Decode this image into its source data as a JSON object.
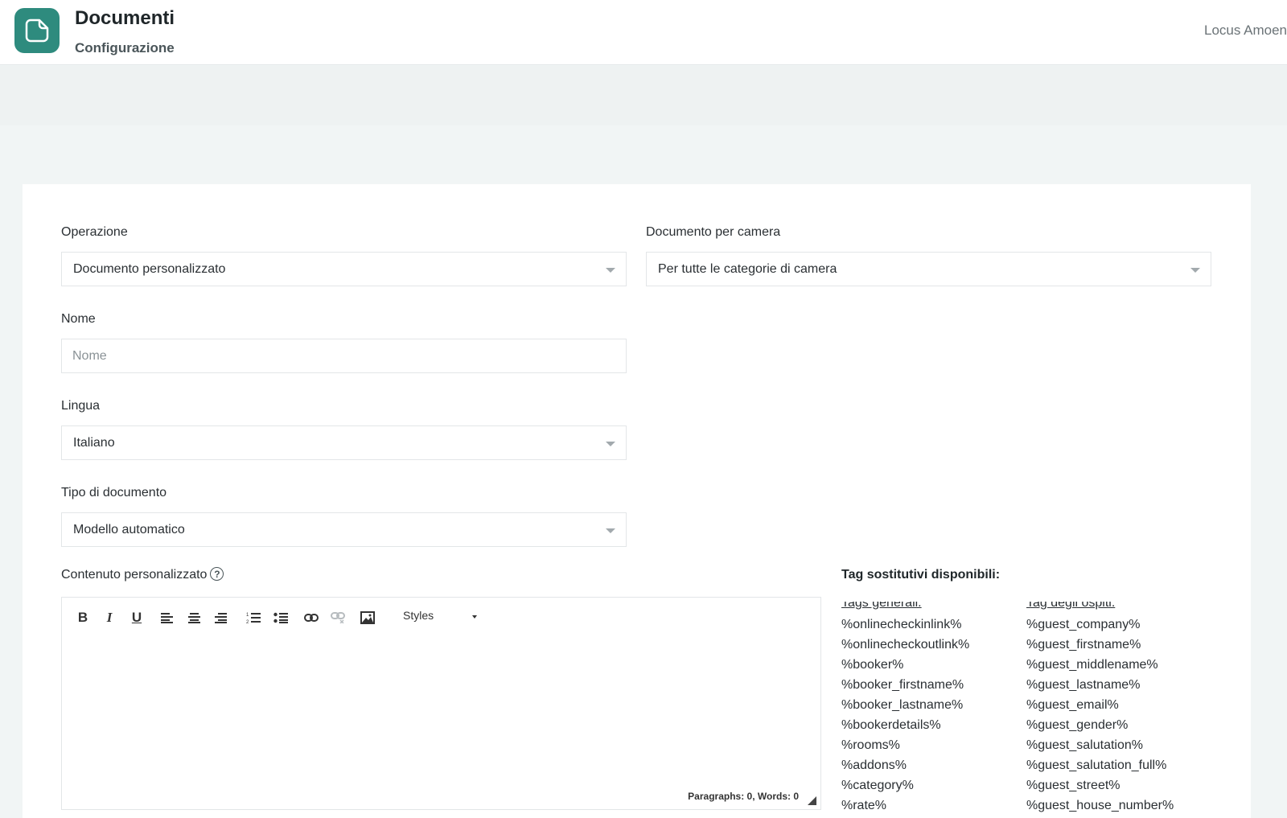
{
  "header": {
    "title": "Documenti",
    "subtitle": "Configurazione",
    "user": "Locus Amoena",
    "icon": "document-icon",
    "accent": "#2e8b7e"
  },
  "form": {
    "operazione": {
      "label": "Operazione",
      "value": "Documento personalizzato"
    },
    "documento_per_camera": {
      "label": "Documento per camera",
      "value": "Per tutte le categorie di camera"
    },
    "nome": {
      "label": "Nome",
      "placeholder": "Nome",
      "value": ""
    },
    "lingua": {
      "label": "Lingua",
      "value": "Italiano"
    },
    "tipo_documento": {
      "label": "Tipo di documento",
      "value": "Modello automatico"
    },
    "contenuto": {
      "label": "Contenuto personalizzato"
    }
  },
  "editor": {
    "toolbar": {
      "bold": "B",
      "italic": "I",
      "underline": "U",
      "styles": "Styles"
    },
    "status": "Paragraphs: 0, Words: 0"
  },
  "tags": {
    "title": "Tag sostitutivi disponibili:",
    "general": {
      "heading": "Tags generali:",
      "items": [
        "%onlinecheckinlink%",
        "%onlinecheckoutlink%",
        "%booker%",
        "%booker_firstname%",
        "%booker_lastname%",
        "%bookerdetails%",
        "%rooms%",
        "%addons%",
        "%category%",
        "%rate%"
      ]
    },
    "guests": {
      "heading": "Tag degli ospiti:",
      "items": [
        "%guest_company%",
        "%guest_firstname%",
        "%guest_middlename%",
        "%guest_lastname%",
        "%guest_email%",
        "%guest_gender%",
        "%guest_salutation%",
        "%guest_salutation_full%",
        "%guest_street%",
        "%guest_house_number%"
      ]
    }
  }
}
